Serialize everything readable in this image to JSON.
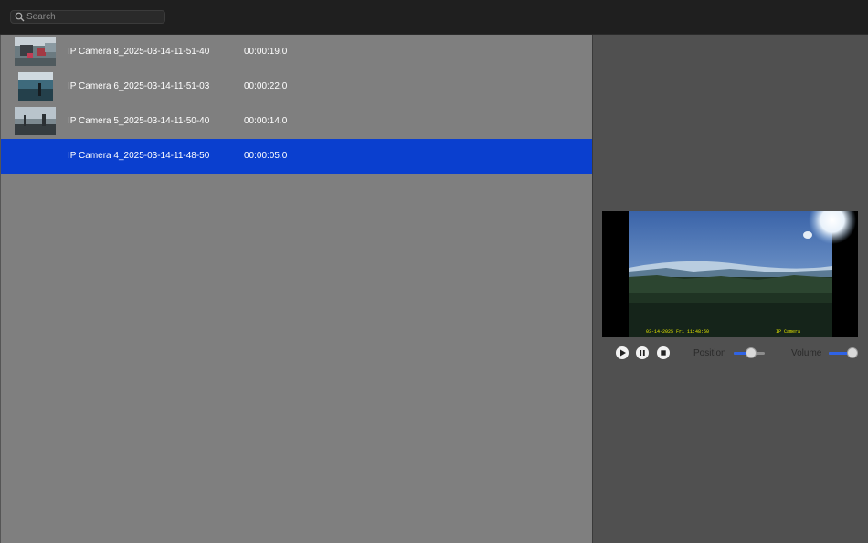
{
  "search": {
    "placeholder": "Search",
    "value": ""
  },
  "recordings": [
    {
      "name": "IP Camera 8_2025-03-14-11-51-40",
      "duration": "00:00:19.0",
      "selected": false
    },
    {
      "name": "IP Camera 6_2025-03-14-11-51-03",
      "duration": "00:00:22.0",
      "selected": false
    },
    {
      "name": "IP Camera 5_2025-03-14-11-50-40",
      "duration": "00:00:14.0",
      "selected": false
    },
    {
      "name": "IP Camera 4_2025-03-14-11-48-50",
      "duration": "00:00:05.0",
      "selected": true
    }
  ],
  "player": {
    "position_label": "Position",
    "volume_label": "Volume",
    "position_fraction": 0.55,
    "volume_fraction": 0.8,
    "play_icon": "play-icon",
    "pause_icon": "pause-icon",
    "stop_icon": "stop-icon"
  },
  "colors": {
    "selection": "#0a3fcf",
    "slider_fill": "#2f63e6"
  }
}
